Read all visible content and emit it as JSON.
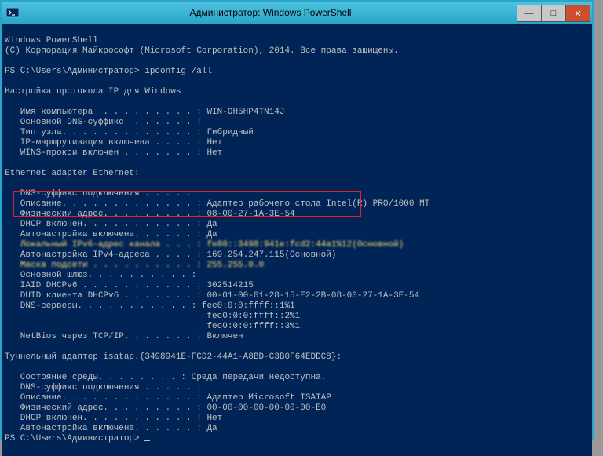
{
  "title": "Администратор: Windows PowerShell",
  "icon": "powershell-icon",
  "buttons": {
    "min": "—",
    "max": "□",
    "close": "✕"
  },
  "lines": {
    "l1": "Windows PowerShell",
    "l2": "(C) Корпорация Майкрософт (Microsoft Corporation), 2014. Все права защищены.",
    "l3": "",
    "l4": "PS C:\\Users\\Администратор> ipconfig /all",
    "l5": "",
    "l6": "Настройка протокола IP для Windows",
    "l7": "",
    "l8": "   Имя компьютера  . . . . . . . . . : WIN-OH5HP4TN14J",
    "l9": "   Основной DNS-суффикс  . . . . . . :",
    "l10": "   Тип узла. . . . . . . . . . . . . : Гибридный",
    "l11": "   IP-маршрутизация включена . . . . : Нет",
    "l12": "   WINS-прокси включен . . . . . . . : Нет",
    "l13": "",
    "l14": "Ethernet adapter Ethernet:",
    "l15": "",
    "l16": "   DNS-суффикс подключения . . . . . :",
    "l17": "   Описание. . . . . . . . . . . . . : Адаптер рабочего стола Intel(R) PRO/1000 MT",
    "l18": "   Физический адрес. . . . . . . . . : 08-00-27-1A-3E-54",
    "l19": "   DHCP включен. . . . . . . . . . . : Да",
    "l20": "   Автонастройка включена. . . . . . : Да",
    "l21": "   Локальный IPv6-адрес канала . . . : fe80::3498:941e:fcd2:44a1%12(Основной)",
    "l22": "   Автонастройка IPv4-адреса . . . . : 169.254.247.115(Основной)",
    "l23": "   Маска подсети . . . . . . . . . . : 255.255.0.0",
    "l24": "   Основной шлюз. . . . . . . . . . :",
    "l25": "   IAID DHCPv6 . . . . . . . . . . . : 302514215",
    "l26": "   DUID клиента DHCPv6 . . . . . . . : 00-01-00-01-28-15-E2-2B-08-00-27-1A-3E-54",
    "l27": "   DNS-серверы. . . . . . . . . . . : fec0:0:0:ffff::1%1",
    "l28": "                                       fec0:0:0:ffff::2%1",
    "l29": "                                       fec0:0:0:ffff::3%1",
    "l30": "   NetBios через TCP/IP. . . . . . . : Включен",
    "l31": "",
    "l32": "Туннельный адаптер isatap.{3498941E-FCD2-44A1-A8BD-C3B0F64EDDC8}:",
    "l33": "",
    "l34": "   Состояние среды. . . . . . . . : Среда передачи недоступна.",
    "l35": "   DNS-суффикс подключения . . . . . :",
    "l36": "   Описание. . . . . . . . . . . . . : Адаптер Microsoft ISATAP",
    "l37": "   Физический адрес. . . . . . . . . : 00-00-00-00-00-00-00-E0",
    "l38": "   DHCP включен. . . . . . . . . . . : Нет",
    "l39": "   Автонастройка включена. . . . . . : Да",
    "l40": "PS C:\\Users\\Администратор> "
  }
}
